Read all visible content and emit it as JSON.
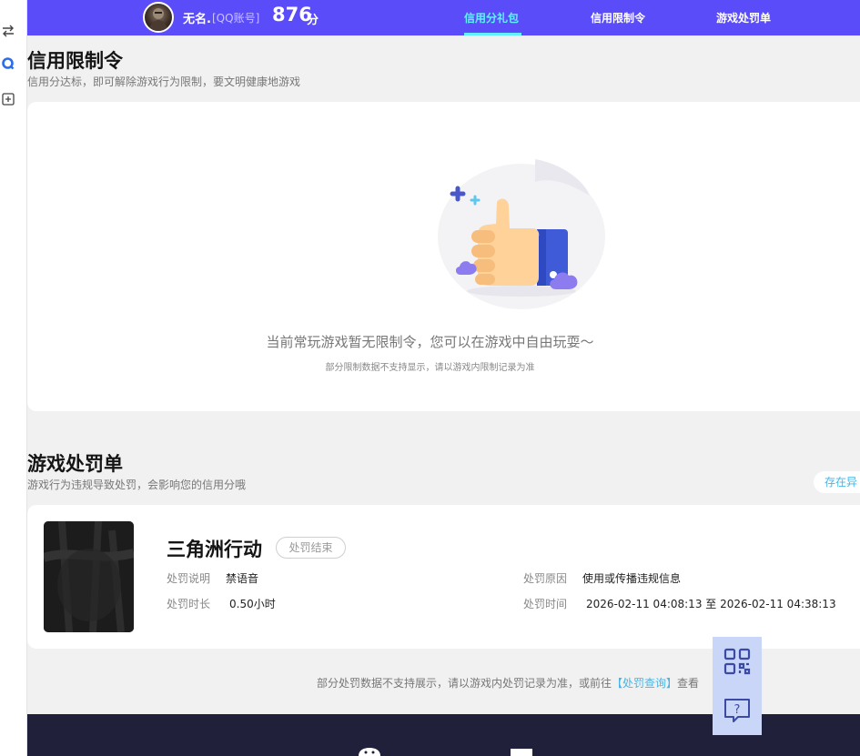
{
  "topbar": {
    "user_name": "无名.",
    "account_type": "[QQ账号]",
    "score": "876",
    "score_unit": "分",
    "tabs": [
      {
        "label": "信用分礼包",
        "active": true
      },
      {
        "label": "信用限制令",
        "active": false
      },
      {
        "label": "游戏处罚单",
        "active": false
      }
    ]
  },
  "restriction": {
    "title": "信用限制令",
    "subtitle": "信用分达标，即可解除游戏行为限制，要文明健康地游戏",
    "empty_main": "当前常玩游戏暂无限制令，您可以在游戏中自由玩耍～",
    "empty_sub": "部分限制数据不支持显示，请以游戏内限制记录为准"
  },
  "penalty": {
    "title": "游戏处罚单",
    "subtitle": "游戏行为违规导致处罚，会影响您的信用分哦",
    "store_button": "存在异",
    "record": {
      "game": "三角洲行动",
      "status": "处罚结束",
      "desc_label": "处罚说明",
      "desc_value": "禁语音",
      "duration_label": "处罚时长",
      "duration_value": "0.50小时",
      "reason_label": "处罚原因",
      "reason_value": "使用或传播违规信息",
      "time_label": "处罚时间",
      "time_start": "2026-02-11 04:08:13",
      "time_sep": "至",
      "time_end": "2026-02-11 04:38:13"
    },
    "note_pre": "部分处罚数据不支持展示，请以游戏内处罚记录为准，或前往",
    "note_link": "【处罚查询】",
    "note_post": "查看"
  },
  "colors": {
    "topbar": "#5b4cf9",
    "active_tab": "#62f0ff",
    "link": "#45b6e6",
    "footer": "#20203a",
    "fab": "#c9d6f8"
  },
  "icons": {
    "rail": [
      "swap-icon",
      "qq-search-icon",
      "add-box-icon"
    ],
    "fab": [
      "qr-code-icon",
      "help-chat-icon"
    ]
  }
}
